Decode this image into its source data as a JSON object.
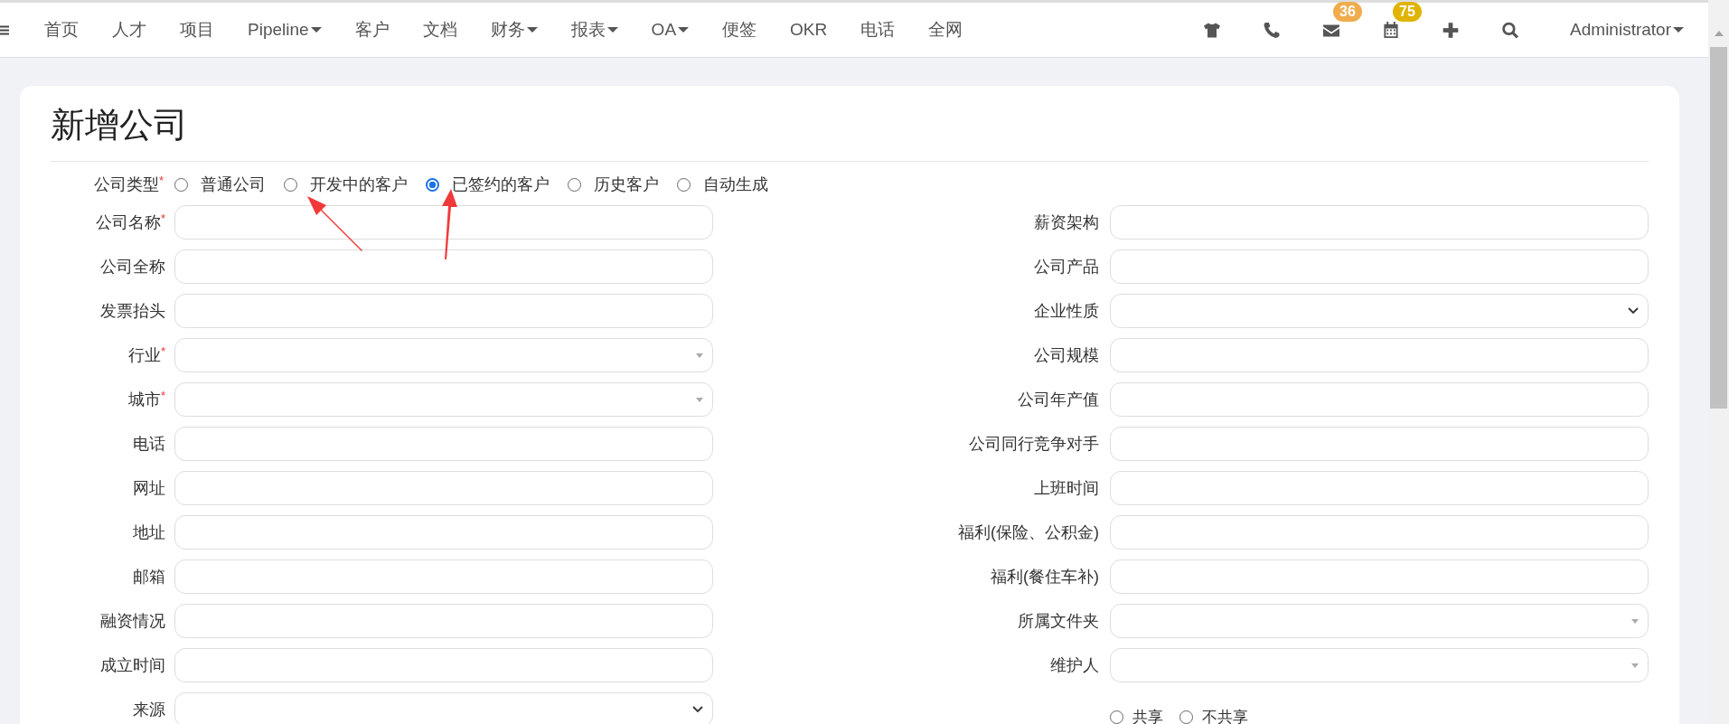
{
  "nav": {
    "menu": [
      {
        "label": "首页",
        "dropdown": false
      },
      {
        "label": "人才",
        "dropdown": false
      },
      {
        "label": "项目",
        "dropdown": false
      },
      {
        "label": "Pipeline",
        "dropdown": true
      },
      {
        "label": "客户",
        "dropdown": false
      },
      {
        "label": "文档",
        "dropdown": false
      },
      {
        "label": "财务",
        "dropdown": true
      },
      {
        "label": "报表",
        "dropdown": true
      },
      {
        "label": "OA",
        "dropdown": true
      },
      {
        "label": "便签",
        "dropdown": false
      },
      {
        "label": "OKR",
        "dropdown": false
      },
      {
        "label": "电话",
        "dropdown": false
      },
      {
        "label": "全网",
        "dropdown": false
      }
    ],
    "tools": [
      {
        "kind": "shirt"
      },
      {
        "kind": "phone"
      },
      {
        "kind": "mail",
        "badge": "36",
        "color": "#f0ad4e"
      },
      {
        "kind": "calendar",
        "badge": "75",
        "color": "#e0b400"
      },
      {
        "kind": "plus"
      },
      {
        "kind": "search"
      }
    ],
    "user": "Administrator"
  },
  "form": {
    "title": "新增公司",
    "required_mark": "*",
    "type_field": {
      "label": "公司类型",
      "required": true,
      "options": [
        {
          "label": "普通公司",
          "selected": false
        },
        {
          "label": "开发中的客户",
          "selected": false
        },
        {
          "label": "已签约的客户",
          "selected": true
        },
        {
          "label": "历史客户",
          "selected": false
        },
        {
          "label": "自动生成",
          "selected": false
        }
      ]
    },
    "rows": [
      {
        "left": {
          "label": "公司名称",
          "required": true,
          "kind": "text"
        },
        "right": {
          "label": "薪资架构",
          "required": false,
          "kind": "text"
        }
      },
      {
        "left": {
          "label": "公司全称",
          "required": false,
          "kind": "text"
        },
        "right": {
          "label": "公司产品",
          "required": false,
          "kind": "text"
        }
      },
      {
        "left": {
          "label": "发票抬头",
          "required": false,
          "kind": "text"
        },
        "right": {
          "label": "企业性质",
          "required": false,
          "kind": "dropdown"
        }
      },
      {
        "left": {
          "label": "行业",
          "required": true,
          "kind": "select"
        },
        "right": {
          "label": "公司规模",
          "required": false,
          "kind": "text"
        }
      },
      {
        "left": {
          "label": "城市",
          "required": true,
          "kind": "select"
        },
        "right": {
          "label": "公司年产值",
          "required": false,
          "kind": "text"
        }
      },
      {
        "left": {
          "label": "电话",
          "required": false,
          "kind": "text"
        },
        "right": {
          "label": "公司同行竞争对手",
          "required": false,
          "kind": "text"
        }
      },
      {
        "left": {
          "label": "网址",
          "required": false,
          "kind": "text"
        },
        "right": {
          "label": "上班时间",
          "required": false,
          "kind": "text"
        }
      },
      {
        "left": {
          "label": "地址",
          "required": false,
          "kind": "text"
        },
        "right": {
          "label": "福利(保险、公积金)",
          "required": false,
          "kind": "text"
        }
      },
      {
        "left": {
          "label": "邮箱",
          "required": false,
          "kind": "text"
        },
        "right": {
          "label": "福利(餐住车补)",
          "required": false,
          "kind": "text"
        }
      },
      {
        "left": {
          "label": "融资情况",
          "required": false,
          "kind": "text"
        },
        "right": {
          "label": "所属文件夹",
          "required": false,
          "kind": "select"
        }
      },
      {
        "left": {
          "label": "成立时间",
          "required": false,
          "kind": "text"
        },
        "right": {
          "label": "维护人",
          "required": false,
          "kind": "select"
        }
      },
      {
        "left": {
          "label": "来源",
          "required": false,
          "kind": "dropdown"
        },
        "right": {
          "kind": "radios",
          "options": [
            {
              "label": "共享",
              "selected": false
            },
            {
              "label": "不共享",
              "selected": false
            }
          ]
        }
      }
    ]
  }
}
